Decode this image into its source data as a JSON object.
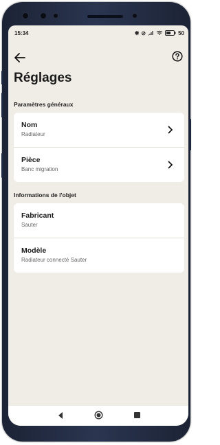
{
  "status_bar": {
    "time": "15:34",
    "battery": "50"
  },
  "header": {
    "title": "Réglages"
  },
  "sections": [
    {
      "title": "Paramètres généraux",
      "items": [
        {
          "label": "Nom",
          "value": "Radiateur"
        },
        {
          "label": "Pièce",
          "value": "Banc migration"
        }
      ]
    },
    {
      "title": "Informations de l'objet",
      "items": [
        {
          "label": "Fabricant",
          "value": "Sauter"
        },
        {
          "label": "Modèle",
          "value": "Radiateur connecté Sauter"
        }
      ]
    }
  ],
  "icons": [
    "back-arrow-icon",
    "help-icon",
    "chevron-right-icon",
    "nav-back-icon",
    "nav-home-icon",
    "nav-recents-icon"
  ],
  "colors": {
    "background": "#f0ede6",
    "card": "#ffffff",
    "text": "#1a1a1a"
  }
}
